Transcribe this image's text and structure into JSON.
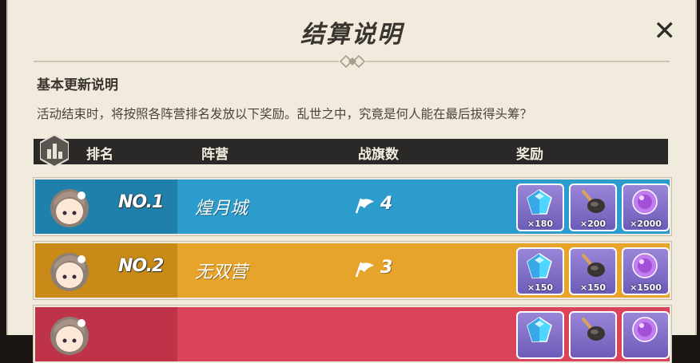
{
  "window": {
    "title": "结算说明",
    "close_label": "✕"
  },
  "section": {
    "title": "基本更新说明",
    "description": "活动结束时，将按照各阵营排名发放以下奖励。乱世之中，究竟是何人能在最后拔得头筹？"
  },
  "table": {
    "headers": {
      "rank": "排名",
      "camp": "阵营",
      "flags": "战旗数",
      "reward": "奖励"
    },
    "rows": [
      {
        "rank": "NO.1",
        "camp": "煌月城",
        "flags": "4",
        "color": "#2b9ccc",
        "color_dark": "#1e80ab",
        "rewards": [
          {
            "icon": "blue-crystal-icon",
            "qty": "×180"
          },
          {
            "icon": "brush-icon",
            "qty": "×200"
          },
          {
            "icon": "purple-orb-icon",
            "qty": "×2000"
          }
        ]
      },
      {
        "rank": "NO.2",
        "camp": "无双营",
        "flags": "3",
        "color": "#e6a42a",
        "color_dark": "#c98a17",
        "rewards": [
          {
            "icon": "blue-crystal-icon",
            "qty": "×150"
          },
          {
            "icon": "brush-icon",
            "qty": "×150"
          },
          {
            "icon": "purple-orb-icon",
            "qty": "×1500"
          }
        ]
      },
      {
        "rank": "",
        "camp": "",
        "flags": "",
        "color": "#d9445a",
        "color_dark": "#be3348",
        "rewards": [
          {
            "icon": "blue-crystal-icon",
            "qty": ""
          },
          {
            "icon": "brush-icon",
            "qty": ""
          },
          {
            "icon": "purple-orb-icon",
            "qty": ""
          }
        ]
      }
    ]
  }
}
